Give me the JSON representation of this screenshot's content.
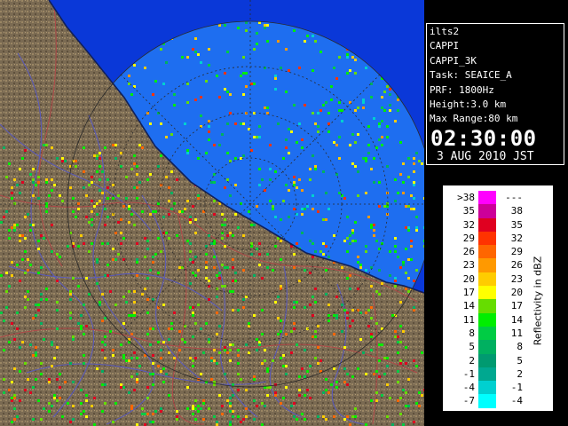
{
  "info": {
    "station": "ilts2",
    "product": "CAPPI",
    "product_code": "CAPPI_3K",
    "task": "Task: SEAICE_A",
    "prf": "PRF: 1800Hz",
    "height": "Height:3.0 km",
    "max_range": "Max Range:80 km",
    "time": "02:30:00",
    "date": "3 AUG 2010 JST"
  },
  "legend": {
    "axis_label": "Reflectivity in dBZ",
    "rows": [
      {
        "lo": ">38",
        "hi": "---",
        "color": "#ff00ff"
      },
      {
        "lo": "35",
        "hi": "38",
        "color": "#cc0099"
      },
      {
        "lo": "32",
        "hi": "35",
        "color": "#e00020"
      },
      {
        "lo": "29",
        "hi": "32",
        "color": "#ff3300"
      },
      {
        "lo": "26",
        "hi": "29",
        "color": "#ff6600"
      },
      {
        "lo": "23",
        "hi": "26",
        "color": "#ff9900"
      },
      {
        "lo": "20",
        "hi": "23",
        "color": "#ffcc00"
      },
      {
        "lo": "17",
        "hi": "20",
        "color": "#ffff00"
      },
      {
        "lo": "14",
        "hi": "17",
        "color": "#66dd00"
      },
      {
        "lo": "11",
        "hi": "14",
        "color": "#00ee00"
      },
      {
        "lo": "8",
        "hi": "11",
        "color": "#00cc44"
      },
      {
        "lo": "5",
        "hi": "8",
        "color": "#00b060"
      },
      {
        "lo": "2",
        "hi": "5",
        "color": "#009a70"
      },
      {
        "lo": "-1",
        "hi": "2",
        "color": "#00a890"
      },
      {
        "lo": "-4",
        "hi": "-1",
        "color": "#00d0d0"
      },
      {
        "lo": "-7",
        "hi": "-4",
        "color": "#00ffff"
      }
    ]
  },
  "colors": {
    "sea_outside_range": "#0a38d8",
    "sea_in_range": "#1e6ef0",
    "land": "#7a6a52",
    "coastline": "#10205a",
    "rivers": "#5a5ab8",
    "roads": "#b04848",
    "range_rings": "#2a2a2a"
  },
  "map_icons": [
    "radar-coverage-disc",
    "coastline",
    "range-rings"
  ]
}
